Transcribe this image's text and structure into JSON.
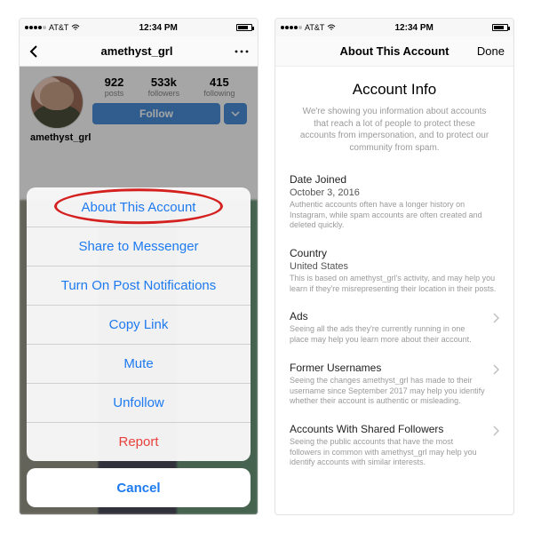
{
  "status": {
    "time": "12:34 PM",
    "net": "AT&T"
  },
  "left": {
    "nav_title": "amethyst_grl",
    "username_line": "amethyst_grl",
    "stats": {
      "posts": {
        "num": "922",
        "label": "posts"
      },
      "followers": {
        "num": "533k",
        "label": "followers"
      },
      "following": {
        "num": "415",
        "label": "following"
      }
    },
    "follow_label": "Follow",
    "sheet": {
      "about": "About This Account",
      "share": "Share to Messenger",
      "notif": "Turn On Post Notifications",
      "copy": "Copy Link",
      "mute": "Mute",
      "unfollow": "Unfollow",
      "report": "Report",
      "cancel": "Cancel"
    }
  },
  "right": {
    "nav_title": "About This Account",
    "done": "Done",
    "header": "Account Info",
    "sub": "We're showing you information about accounts that reach a lot of people to protect these accounts from impersonation, and to protect our community from spam.",
    "joined": {
      "label": "Date Joined",
      "value": "October 3, 2016",
      "desc": "Authentic accounts often have a longer history on Instagram, while spam accounts are often created and deleted quickly."
    },
    "country": {
      "label": "Country",
      "value": "United States",
      "desc": "This is based on amethyst_grl's activity, and may help you learn if they're misrepresenting their location in their posts."
    },
    "ads": {
      "label": "Ads",
      "desc": "Seeing all the ads they're currently running in one place may help you learn more about their account."
    },
    "former": {
      "label": "Former Usernames",
      "desc": "Seeing the changes amethyst_grl has made to their username since September 2017 may help you identify whether their account is authentic or misleading."
    },
    "shared": {
      "label": "Accounts With Shared Followers",
      "desc": "Seeing the public accounts that have the most followers in common with amethyst_grl may help you identify accounts with similar interests."
    }
  }
}
